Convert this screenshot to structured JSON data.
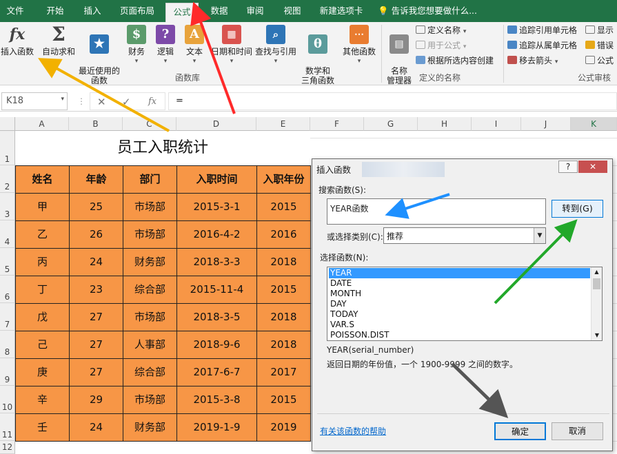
{
  "tabs": [
    "文件",
    "开始",
    "插入",
    "页面布局",
    "公式",
    "数据",
    "审阅",
    "视图",
    "新建选项卡"
  ],
  "tell_me": "告诉我您想要做什么...",
  "ribbon": {
    "library": [
      "插入函数",
      "自动求和",
      "最近使用的\n函数",
      "财务",
      "逻辑",
      "文本",
      "日期和时间",
      "查找与引用",
      "数学和\n三角函数",
      "其他函数"
    ],
    "library_group": "函数库",
    "name_manager": "名称\n管理器",
    "define_name": "定义名称",
    "use_in_formula": "用于公式",
    "create_from_selection": "根据所选内容创建",
    "names_group": "定义的名称",
    "trace_precedents": "追踪引用单元格",
    "trace_dependents": "追踪从属单元格",
    "remove_arrows": "移去箭头",
    "show_formulas": "显示",
    "error_checking": "错误",
    "evaluate": "公式",
    "audit_group": "公式审核"
  },
  "formula_bar": {
    "name_box": "K18",
    "content": "="
  },
  "columns": [
    "A",
    "B",
    "C",
    "D",
    "E",
    "F",
    "G",
    "H",
    "I",
    "J",
    "K"
  ],
  "rows": [
    "1",
    "2",
    "3",
    "4",
    "5",
    "6",
    "7",
    "8",
    "9",
    "10",
    "11",
    "12"
  ],
  "sheet": {
    "title": "员工入职统计",
    "headers": [
      "姓名",
      "年龄",
      "部门",
      "入职时间",
      "入职年份"
    ],
    "data": [
      [
        "甲",
        "25",
        "市场部",
        "2015-3-1",
        "2015"
      ],
      [
        "乙",
        "26",
        "市场部",
        "2016-4-2",
        "2016"
      ],
      [
        "丙",
        "24",
        "财务部",
        "2018-3-3",
        "2018"
      ],
      [
        "丁",
        "23",
        "综合部",
        "2015-11-4",
        "2015"
      ],
      [
        "戊",
        "27",
        "市场部",
        "2018-3-5",
        "2018"
      ],
      [
        "己",
        "27",
        "人事部",
        "2018-9-6",
        "2018"
      ],
      [
        "庚",
        "27",
        "综合部",
        "2017-6-7",
        "2017"
      ],
      [
        "辛",
        "29",
        "市场部",
        "2015-3-8",
        "2015"
      ],
      [
        "壬",
        "24",
        "财务部",
        "2019-1-9",
        "2019"
      ]
    ]
  },
  "dialog": {
    "title": "插入函数",
    "search_label": "搜索函数(S):",
    "search_value": "YEAR函数",
    "go_button": "转到(G)",
    "category_label": "或选择类别(C):",
    "category_value": "推荐",
    "select_label": "选择函数(N):",
    "functions": [
      "YEAR",
      "DATE",
      "MONTH",
      "DAY",
      "TODAY",
      "VAR.S",
      "POISSON.DIST"
    ],
    "signature": "YEAR(serial_number)",
    "description": "返回日期的年份值，一个 1900-9999 之间的数字。",
    "help_link": "有关该函数的帮助",
    "ok_button": "确定",
    "cancel_button": "取消",
    "help_icon": "?",
    "close_icon": "✕"
  }
}
